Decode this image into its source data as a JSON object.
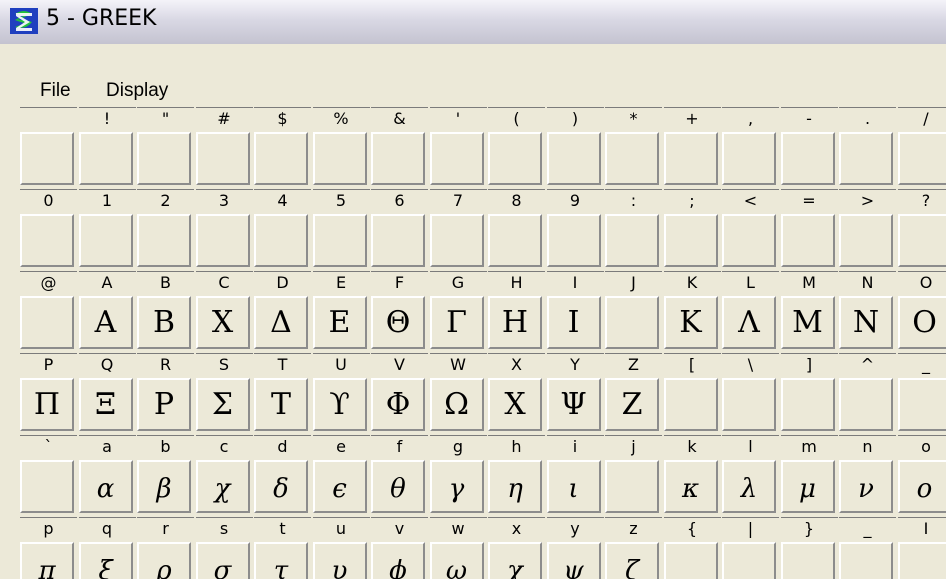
{
  "window": {
    "title": "5 - GREEK"
  },
  "menu": {
    "file": "File",
    "display": "Display"
  },
  "rows": [
    {
      "headers": [
        " ",
        "!",
        "\"",
        "#",
        "$",
        "%",
        "&",
        "'",
        "(",
        ")",
        "*",
        "+",
        ",",
        "-",
        ".",
        "/"
      ],
      "glyphs": [
        "",
        "",
        "",
        "",
        "",
        "",
        "",
        "",
        "",
        "",
        "",
        "",
        "",
        "",
        "",
        ""
      ]
    },
    {
      "headers": [
        "0",
        "1",
        "2",
        "3",
        "4",
        "5",
        "6",
        "7",
        "8",
        "9",
        ":",
        ";",
        "<",
        "=",
        ">",
        "?"
      ],
      "glyphs": [
        "",
        "",
        "",
        "",
        "",
        "",
        "",
        "",
        "",
        "",
        "",
        "",
        "",
        "",
        "",
        ""
      ]
    },
    {
      "headers": [
        "@",
        "A",
        "B",
        "C",
        "D",
        "E",
        "F",
        "G",
        "H",
        "I",
        "J",
        "K",
        "L",
        "M",
        "N",
        "O"
      ],
      "glyphs": [
        "",
        "Α",
        "Β",
        "Χ",
        "Δ",
        "Ε",
        "Θ",
        "Γ",
        "Η",
        "Ι",
        "",
        "Κ",
        "Λ",
        "Μ",
        "Ν",
        "Ο"
      ]
    },
    {
      "headers": [
        "P",
        "Q",
        "R",
        "S",
        "T",
        "U",
        "V",
        "W",
        "X",
        "Y",
        "Z",
        "[",
        "\\",
        "]",
        "^",
        "_"
      ],
      "glyphs": [
        "Π",
        "Ξ",
        "Ρ",
        "Σ",
        "Τ",
        "ϒ",
        "Φ",
        "Ω",
        "Χ",
        "Ψ",
        "Ζ",
        "",
        "",
        "",
        "",
        ""
      ]
    },
    {
      "headers": [
        "`",
        "a",
        "b",
        "c",
        "d",
        "e",
        "f",
        "g",
        "h",
        "i",
        "j",
        "k",
        "l",
        "m",
        "n",
        "o"
      ],
      "glyphs": [
        "",
        "α",
        "β",
        "χ",
        "δ",
        "ϵ",
        "θ",
        "γ",
        "η",
        "ι",
        "",
        "κ",
        "λ",
        "μ",
        "ν",
        "ο"
      ]
    },
    {
      "headers": [
        "p",
        "q",
        "r",
        "s",
        "t",
        "u",
        "v",
        "w",
        "x",
        "y",
        "z",
        "{",
        "|",
        "}",
        "_",
        "I"
      ],
      "glyphs": [
        "π",
        "ξ",
        "ρ",
        "σ",
        "τ",
        "υ",
        "ϕ",
        "ω",
        "χ",
        "ψ",
        "ζ",
        "",
        "",
        "",
        "",
        ""
      ]
    }
  ]
}
